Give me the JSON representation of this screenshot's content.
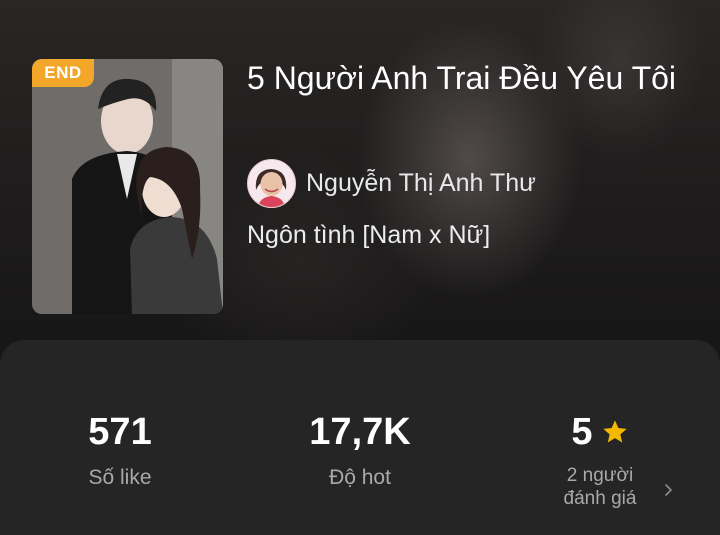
{
  "story": {
    "badge": "END",
    "title": "5 Người Anh Trai Đều Yêu Tôi",
    "author": "Nguyễn Thị Anh Thư",
    "genre": "Ngôn tình [Nam x Nữ]"
  },
  "stats": {
    "likes": {
      "value": "571",
      "label": "Số like"
    },
    "hot": {
      "value": "17,7K",
      "label": "Độ hot"
    },
    "rating": {
      "value": "5",
      "label_line1": "2 người",
      "label_line2": "đánh giá"
    }
  },
  "colors": {
    "badge": "#f2a62a",
    "star": "#f5b800",
    "panel": "#252525"
  }
}
